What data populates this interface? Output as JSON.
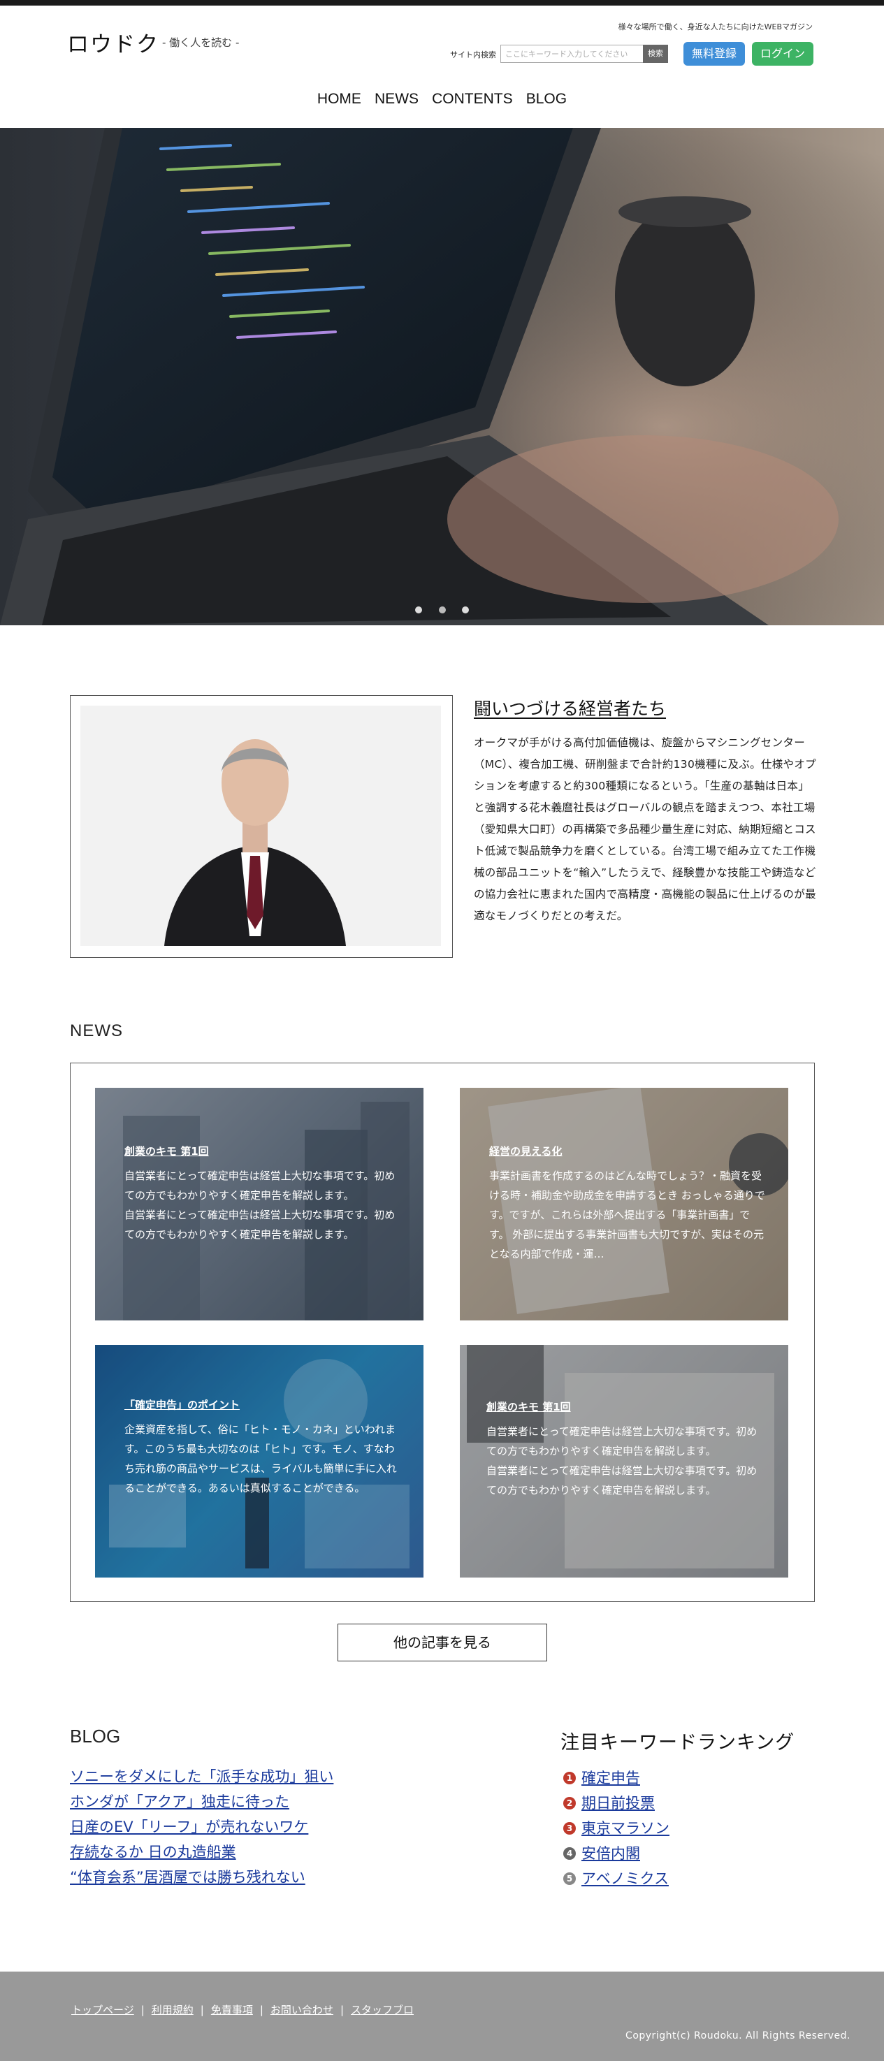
{
  "header": {
    "logo": "ロウドク",
    "logo_sub": "- 働く人を読む -",
    "tagline": "様々な場所で働く、身近な人たちに向けたWEBマガジン",
    "search_label": "サイト内検索",
    "search_placeholder": "ここにキーワード入力してください",
    "search_button": "検索",
    "register_button": "無料登録",
    "login_button": "ログイン"
  },
  "nav": {
    "items": [
      {
        "label": "HOME"
      },
      {
        "label": "NEWS"
      },
      {
        "label": "CONTENTS"
      },
      {
        "label": "BLOG"
      }
    ]
  },
  "hero": {
    "slide_count": 3,
    "active_slide": 1
  },
  "feature": {
    "title": "闘いつづける経営者たち",
    "body": "オークマが手がける高付加価値機は、旋盤からマシニングセンター（MC）、複合加工機、研削盤まで合計約130機種に及ぶ。仕様やオプションを考慮すると約300種類になるという。「生産の基軸は日本」と強調する花木義麿社長はグローバルの観点を踏まえつつ、本社工場（愛知県大口町）の再構築で多品種少量生産に対応、納期短縮とコスト低減で製品競争力を磨くとしている。台湾工場で組み立てた工作機械の部品ユニットを“輸入”したうえで、経験豊かな技能工や鋳造などの協力会社に恵まれた国内で高精度・高機能の製品に仕上げるのが最適なモノづくりだとの考えだ。"
  },
  "news": {
    "heading": "NEWS",
    "cards": [
      {
        "title": "創業のキモ 第1回",
        "lines": [
          "自営業者にとって確定申告は経営上大切な事項です。初めての方でもわかりやすく確定申告を解説します。",
          "自営業者にとって確定申告は経営上大切な事項です。初めての方でもわかりやすく確定申告を解説します。"
        ]
      },
      {
        "title": "経営の見える化",
        "lines": [
          "事業計画書を作成するのはどんな時でしょう？・融資を受ける時・補助金や助成金を申請するとき おっしゃる通りです。ですが、これらは外部へ提出する「事業計画書」です。 外部に提出する事業計画書も大切ですが、実はその元となる内部で作成・運…"
        ]
      },
      {
        "title": "「確定申告」のポイント",
        "lines": [
          "企業資産を指して、俗に「ヒト・モノ・カネ」といわれます。このうち最も大切なのは「ヒト」です。モノ、すなわち売れ筋の商品やサービスは、ライバルも簡単に手に入れることができる。あるいは真似することができる。"
        ]
      },
      {
        "title": "創業のキモ 第1回",
        "lines": [
          "自営業者にとって確定申告は経営上大切な事項です。初めての方でもわかりやすく確定申告を解説します。",
          "自営業者にとって確定申告は経営上大切な事項です。初めての方でもわかりやすく確定申告を解説します。"
        ]
      }
    ],
    "more_button": "他の記事を見る"
  },
  "blog": {
    "heading": "BLOG",
    "items": [
      "ソニーをダメにした「派手な成功」狙い",
      "ホンダが「アクア」独走に待った",
      "日産のEV「リーフ」が売れないワケ",
      "存続なるか 日の丸造船業",
      "“体育会系”居酒屋では勝ち残れない"
    ]
  },
  "ranking": {
    "heading": "注目キーワードランキング",
    "items": [
      {
        "rank": "1",
        "label": "確定申告",
        "color": "#c0392b"
      },
      {
        "rank": "2",
        "label": "期日前投票",
        "color": "#c0392b"
      },
      {
        "rank": "3",
        "label": "東京マラソン",
        "color": "#c0392b"
      },
      {
        "rank": "4",
        "label": "安倍内閣",
        "color": "#666666"
      },
      {
        "rank": "5",
        "label": "アベノミクス",
        "color": "#888888"
      }
    ]
  },
  "footer": {
    "links": [
      "トップページ",
      "利用規約",
      "免責事項",
      "お問い合わせ",
      "スタッフブロ"
    ],
    "copyright": "Copyright(c) Roudoku. All Rights Reserved."
  },
  "colors": {
    "register": "#3e8ed8",
    "login": "#3db364",
    "link": "#1a3a9c",
    "footer": "#999999"
  }
}
